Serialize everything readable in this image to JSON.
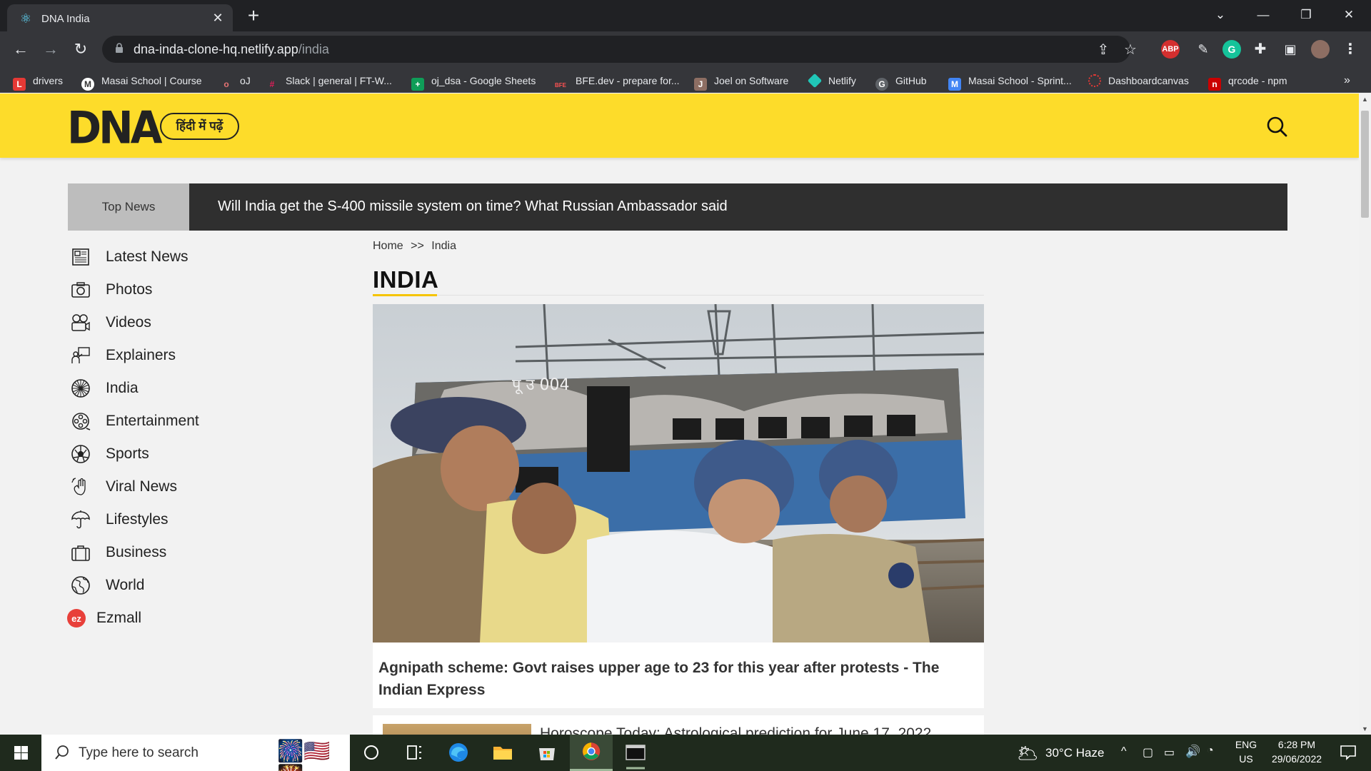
{
  "browser": {
    "tab_title": "DNA India",
    "new_tab_label": "+",
    "url_host": "dna-inda-clone-hq.netlify.app",
    "url_path": "/india",
    "bookmarks": [
      {
        "label": "drivers",
        "icon": "L",
        "color": "#e53935"
      },
      {
        "label": "Masai School | Course",
        "icon": "M",
        "color": "#ffffff"
      },
      {
        "label": "oJ",
        "icon": "o",
        "color": "#e57373"
      },
      {
        "label": "Slack | general | FT-W...",
        "icon": "#",
        "color": "#e01e5a"
      },
      {
        "label": "oj_dsa - Google Sheets",
        "icon": "+",
        "color": "#0f9d58"
      },
      {
        "label": "BFE.dev - prepare for...",
        "icon": "BFE",
        "color": "#ff5252"
      },
      {
        "label": "Joel on Software",
        "icon": "J",
        "color": "#8d6e63"
      },
      {
        "label": "Netlify",
        "icon": "N",
        "color": "#20c6b7"
      },
      {
        "label": "GitHub",
        "icon": "G",
        "color": "#5f6368"
      },
      {
        "label": "Masai School - Sprint...",
        "icon": "M",
        "color": "#4285f4"
      },
      {
        "label": "Dashboardcanvas",
        "icon": "D",
        "color": "#e53935"
      },
      {
        "label": "qrcode - npm",
        "icon": "n",
        "color": "#cb0000"
      }
    ],
    "extensions": [
      {
        "name": "ABP",
        "color": "#d32f2f"
      },
      {
        "name": "G",
        "color": "#15c39a"
      }
    ]
  },
  "site": {
    "logo": "DNA",
    "hindi_button": "हिंदी में पढ़ें",
    "brand_yellow": "#fddc2a",
    "top_news_label": "Top News",
    "top_news_headline": "Will India get the S-400 missile system on time? What Russian Ambassador said",
    "nav": [
      {
        "label": "Latest News",
        "icon": "newspaper-icon"
      },
      {
        "label": "Photos",
        "icon": "camera-icon"
      },
      {
        "label": "Videos",
        "icon": "video-camera-icon"
      },
      {
        "label": "Explainers",
        "icon": "presenter-icon"
      },
      {
        "label": "India",
        "icon": "ashoka-chakra-icon"
      },
      {
        "label": "Entertainment",
        "icon": "film-reel-icon"
      },
      {
        "label": "Sports",
        "icon": "football-icon"
      },
      {
        "label": "Viral News",
        "icon": "viral-hand-icon"
      },
      {
        "label": "Lifestyles",
        "icon": "umbrella-icon"
      },
      {
        "label": "Business",
        "icon": "briefcase-icon"
      },
      {
        "label": "World",
        "icon": "globe-icon"
      },
      {
        "label": "Ezmall",
        "icon": "ezmall-logo-icon"
      }
    ],
    "breadcrumb": {
      "home": "Home",
      "separator": ">>",
      "current": "India"
    },
    "page_title": "INDIA",
    "lead_story": {
      "headline": "Agnipath scheme: Govt raises upper age to 23 for this year after protests - The Indian Express",
      "coach_marking": "पू उ 004"
    },
    "second_story": {
      "headline": "Horoscope Today: Astrological prediction for June 17, 2022"
    }
  },
  "taskbar": {
    "search_placeholder": "Type here to search",
    "weather": "30°C  Haze",
    "language": "ENG",
    "region": "US",
    "time": "6:28 PM",
    "date": "29/06/2022"
  }
}
